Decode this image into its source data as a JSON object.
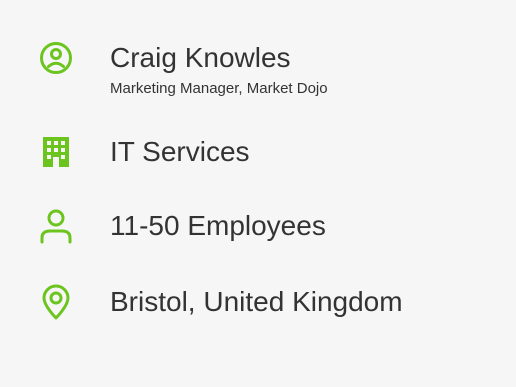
{
  "accent_color": "#6cc51f",
  "contact": {
    "name": "Craig Knowles",
    "title": "Marketing Manager, Market Dojo",
    "icon": "user-circle-icon"
  },
  "industry": {
    "label": "IT Services",
    "icon": "building-icon"
  },
  "company_size": {
    "label": "11-50 Employees",
    "icon": "person-icon"
  },
  "location": {
    "label": "Bristol, United Kingdom",
    "icon": "location-pin-icon"
  }
}
